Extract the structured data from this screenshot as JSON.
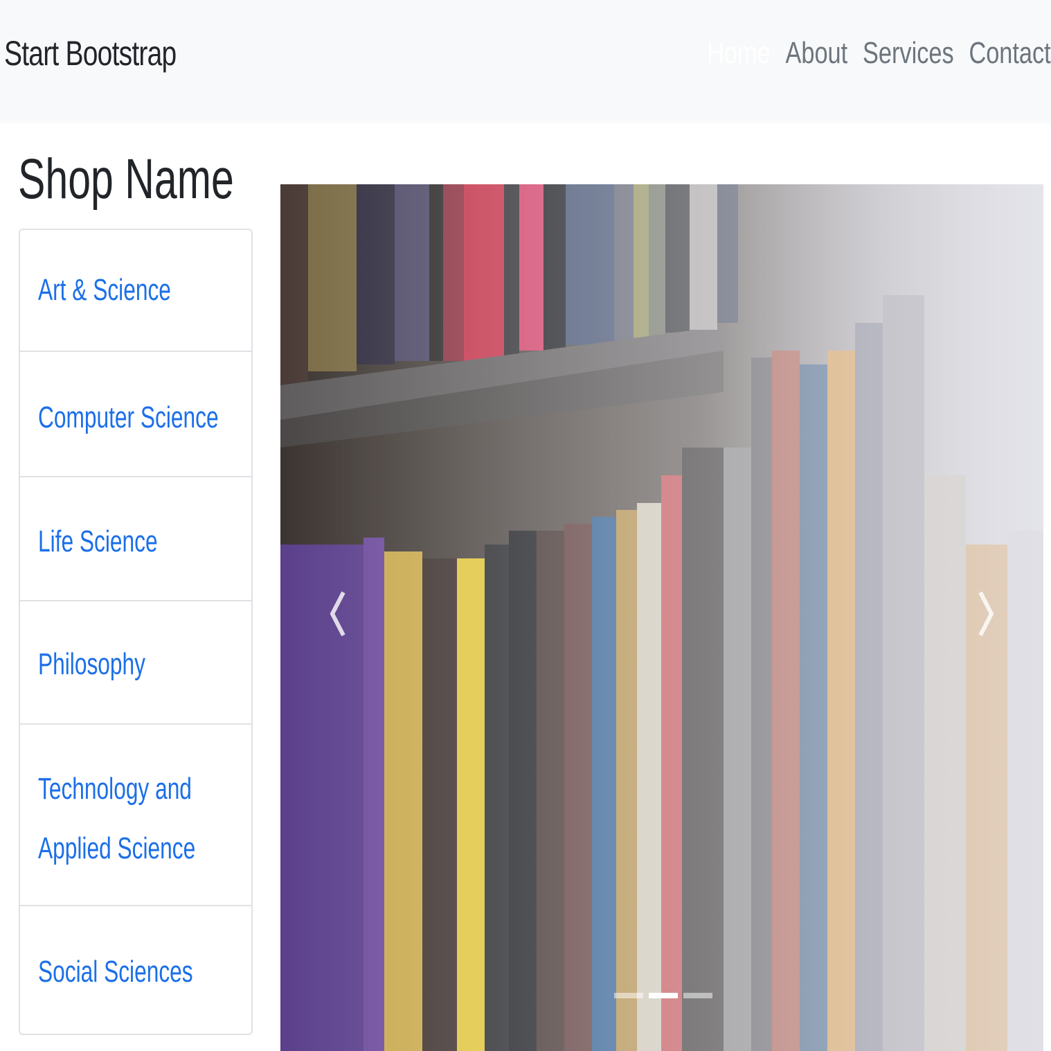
{
  "navbar": {
    "brand": "Start Bootstrap",
    "links": [
      {
        "label": "Home",
        "active": true
      },
      {
        "label": "About",
        "active": false
      },
      {
        "label": "Services",
        "active": false
      },
      {
        "label": "Contact",
        "active": false
      }
    ]
  },
  "sidebar": {
    "title": "Shop Name",
    "items": [
      {
        "label": "Art & Science"
      },
      {
        "label": "Computer Science"
      },
      {
        "label": "Life Science"
      },
      {
        "label": "Philosophy"
      },
      {
        "label": "Technology and Applied Science"
      },
      {
        "label": "Social Sciences"
      }
    ]
  },
  "carousel": {
    "slide_count": 3,
    "active_slide": 2,
    "prev_icon": "chevron-left-icon",
    "next_icon": "chevron-right-icon"
  },
  "colors": {
    "navbar_bg": "#f8f9fa",
    "link_blue": "#1b6fe8",
    "muted_nav": "#6c757d",
    "text_dark": "#212529"
  }
}
